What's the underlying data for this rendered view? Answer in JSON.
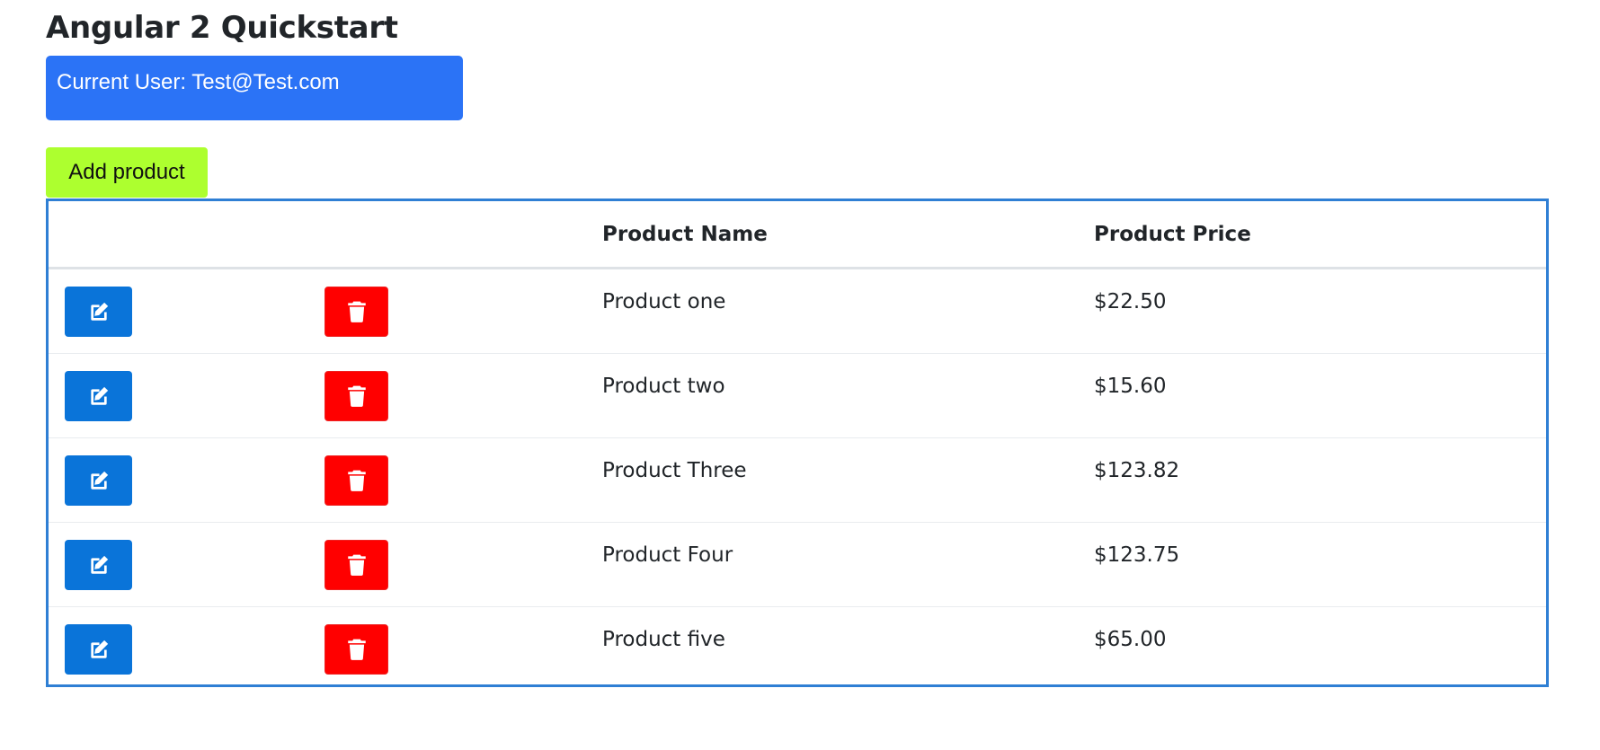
{
  "header": {
    "title": "Angular 2 Quickstart"
  },
  "user_box": {
    "text": "Current User: Test@Test.com",
    "color": "#2b73f6"
  },
  "toolbar": {
    "add_label": "Add product",
    "add_color": "#adff2f"
  },
  "table": {
    "columns": [
      "",
      "",
      "Product Name",
      "Product Price"
    ],
    "rows": [
      {
        "name": "Product one",
        "price": "$22.50"
      },
      {
        "name": "Product two",
        "price": "$15.60"
      },
      {
        "name": "Product Three",
        "price": "$123.82"
      },
      {
        "name": "Product Four",
        "price": "$123.75"
      },
      {
        "name": "Product five",
        "price": "$65.00"
      }
    ],
    "row_actions": {
      "edit_icon": "edit-icon",
      "delete_icon": "trash-icon",
      "edit_color": "#0a74d9",
      "delete_color": "#ff0000"
    }
  }
}
